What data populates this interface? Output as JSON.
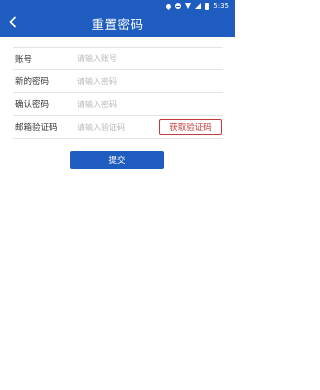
{
  "status_bar": {
    "time": "5:35",
    "icons": [
      "location-icon",
      "dnd-icon",
      "wifi-icon",
      "signal-icon",
      "battery-icon"
    ]
  },
  "header": {
    "title": "重置密码",
    "back_icon": "chevron-left-icon"
  },
  "form": {
    "account": {
      "label": "账号",
      "placeholder": "请输入账号"
    },
    "new_password": {
      "label": "新的密码",
      "placeholder": "请输入密码"
    },
    "confirm_password": {
      "label": "确认密码",
      "placeholder": "请输入密码"
    },
    "email_code": {
      "label": "邮箱验证码",
      "placeholder": "请输入验证码",
      "button_label": "获取验证码"
    }
  },
  "submit_label": "提交",
  "colors": {
    "primary": "#1e5dbf",
    "accent_red": "#c23a3a",
    "placeholder": "#b8b8b8"
  }
}
